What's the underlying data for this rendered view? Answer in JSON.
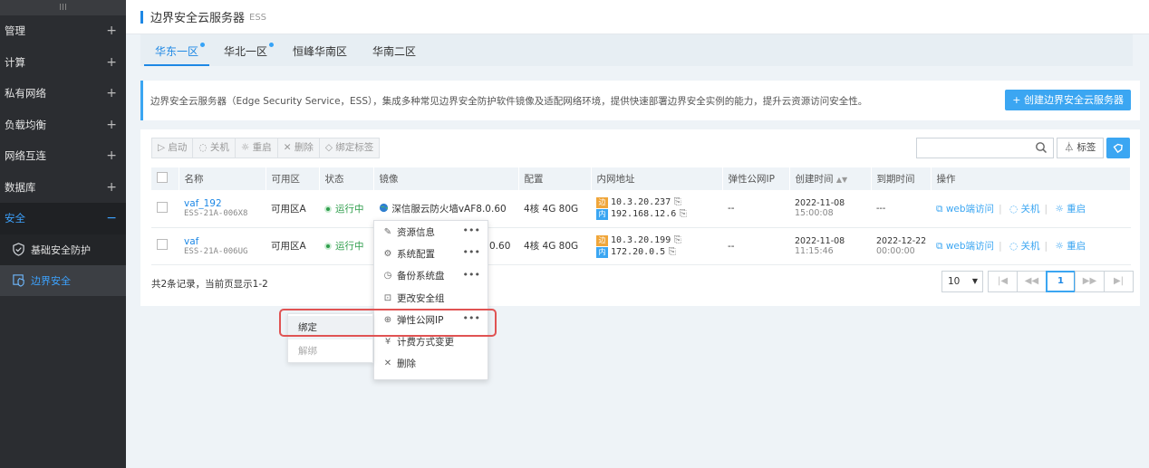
{
  "sidebar": {
    "top_label": "III",
    "items": [
      {
        "label": "管理",
        "toggle": "+"
      },
      {
        "label": "计算",
        "toggle": "+"
      },
      {
        "label": "私有网络",
        "toggle": "+"
      },
      {
        "label": "负载均衡",
        "toggle": "+"
      },
      {
        "label": "网络互连",
        "toggle": "+"
      },
      {
        "label": "数据库",
        "toggle": "+"
      },
      {
        "label": "安全",
        "toggle": "−"
      }
    ],
    "subitems": [
      {
        "label": "基础安全防护"
      },
      {
        "label": "边界安全"
      }
    ]
  },
  "header": {
    "title": "边界安全云服务器",
    "subtitle": "ESS"
  },
  "tabs": [
    {
      "label": "华东一区"
    },
    {
      "label": "华北一区"
    },
    {
      "label": "恒峰华南区"
    },
    {
      "label": "华南二区"
    }
  ],
  "info": {
    "text": "边界安全云服务器（Edge Security Service，ESS），集成多种常见边界安全防护软件镜像及适配网络环境，提供快速部署边界安全实例的能力，提升云资源访问安全性。",
    "create_button": "+ 创建边界安全云服务器"
  },
  "toolbar": {
    "start": "▷ 启动",
    "stop": "◌ 关机",
    "restart": "☼ 重启",
    "delete": "✕ 删除",
    "bind_tag": "◇ 绑定标签",
    "tag_button": "标签"
  },
  "table": {
    "headers": [
      "名称",
      "可用区",
      "状态",
      "镜像",
      "配置",
      "内网地址",
      "弹性公网IP",
      "创建时间",
      "到期时间",
      "操作"
    ],
    "rows": [
      {
        "name": "vaf_192",
        "id": "ESS-21A-006X8",
        "zone": "可用区A",
        "status": "运行中",
        "image": "深信服云防火墙vAF8.0.60",
        "config": "4核 4G 80G",
        "ip_out_tag": "边",
        "ip_out": "10.3.20.237",
        "ip_in_tag": "内",
        "ip_in": "192.168.12.6",
        "eip": "--",
        "created_date": "2022-11-08",
        "created_time": "15:00:08",
        "expire_date": "---",
        "expire_time": "",
        "op_web": "web端访问",
        "op_stop": "关机",
        "op_restart": "重启"
      },
      {
        "name": "vaf",
        "id": "ESS-21A-006UG",
        "zone": "可用区A",
        "status": "运行中",
        "image": "0.60",
        "config": "4核 4G 80G",
        "ip_out_tag": "边",
        "ip_out": "10.3.20.199",
        "ip_in_tag": "内",
        "ip_in": "172.20.0.5",
        "eip": "--",
        "created_date": "2022-11-08",
        "created_time": "11:15:46",
        "expire_date": "2022-12-22",
        "expire_time": "00:00:00",
        "op_web": "web端访问",
        "op_stop": "关机",
        "op_restart": "重启"
      }
    ]
  },
  "footer": {
    "summary": "共2条记录，当前页显示1-2"
  },
  "pagination": {
    "page_size": "10",
    "current_page": "1"
  },
  "context_menu": {
    "items": [
      {
        "icon": "✎",
        "label": "资源信息",
        "more": "•••"
      },
      {
        "icon": "⚙",
        "label": "系统配置",
        "more": "•••"
      },
      {
        "icon": "◷",
        "label": "备份系统盘",
        "more": "•••"
      },
      {
        "icon": "⊡",
        "label": "更改安全组",
        "more": ""
      },
      {
        "icon": "⊕",
        "label": "弹性公网IP",
        "more": "•••"
      },
      {
        "icon": "¥",
        "label": "计费方式变更",
        "more": ""
      },
      {
        "icon": "✕",
        "label": "删除",
        "more": ""
      }
    ]
  },
  "submenu": {
    "bind": "绑定",
    "unbind": "解绑"
  }
}
